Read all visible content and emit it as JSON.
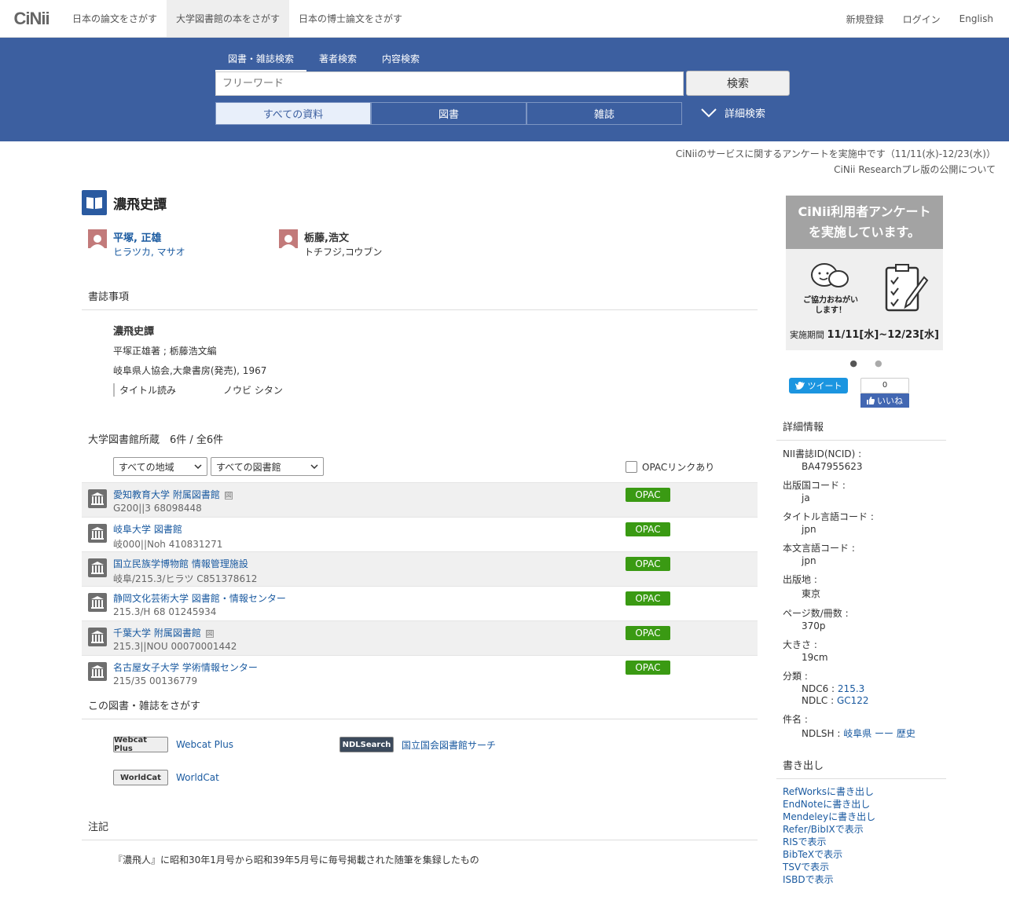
{
  "header": {
    "logo": "CiNii",
    "tabs": [
      "日本の論文をさがす",
      "大学図書館の本をさがす",
      "日本の博士論文をさがす"
    ],
    "right": [
      "新規登録",
      "ログイン",
      "English"
    ]
  },
  "search": {
    "tabs": [
      "図書・雑誌検索",
      "著者検索",
      "内容検索"
    ],
    "placeholder": "フリーワード",
    "button": "検索",
    "material_tabs": [
      "すべての資料",
      "図書",
      "雑誌"
    ],
    "advanced": "詳細検索"
  },
  "notices": [
    "CiNiiのサービスに関するアンケートを実施中です（11/11(水)-12/23(水)）",
    "CiNii Researchプレ版の公開について"
  ],
  "book": {
    "title": "濃飛史譚",
    "authors": [
      {
        "name": "平塚, 正雄",
        "kana": "ヒラツカ, マサオ"
      },
      {
        "name": "栃藤,浩文",
        "kana": "トチフジ,コウブン"
      }
    ]
  },
  "biblio": {
    "heading": "書誌事項",
    "title": "濃飛史譚",
    "resp": "平塚正雄著 ; 栃藤浩文編",
    "pub": "岐阜県人協会,大衆書房(発売), 1967",
    "yomi_label": "タイトル読み",
    "yomi_value": "ノウビ シタン"
  },
  "holdings": {
    "heading": "大学図書館所蔵　6件 / 全6件",
    "region_select": "すべての地域",
    "library_select": "すべての図書館",
    "opac_check": "OPACリンクあり",
    "opac_label": "OPAC",
    "fig_icon": "図",
    "items": [
      {
        "name": "愛知教育大学 附属図書館",
        "call": "G200||3  68098448",
        "fig": true
      },
      {
        "name": "岐阜大学 図書館",
        "call": "岐000||Noh  410831271",
        "fig": false
      },
      {
        "name": "国立民族学博物館 情報管理施設",
        "call": "岐阜/215.3/ヒラツ  C851378612",
        "fig": false
      },
      {
        "name": "静岡文化芸術大学 図書館・情報センター",
        "call": "215.3/H 68  01245934",
        "fig": false
      },
      {
        "name": "千葉大学 附属図書館",
        "call": "215.3||NOU  00070001442",
        "fig": true
      },
      {
        "name": "名古屋女子大学 学術情報センター",
        "call": "215/35  00136779",
        "fig": false
      }
    ]
  },
  "external": {
    "heading": "この図書・雑誌をさがす",
    "webcat_badge": "Webcat Plus",
    "webcat": "Webcat Plus",
    "ndl_badge": "NDLSearch",
    "ndl": "国立国会図書館サーチ",
    "worldcat_badge": "WorldCat",
    "worldcat": "WorldCat"
  },
  "notes": {
    "heading": "注記",
    "text": "『濃飛人』に昭和30年1月号から昭和39年5月号に毎号掲載された随筆を集録したもの"
  },
  "promo": {
    "line1": "CiNii利用者アンケート",
    "line2": "を実施しています。",
    "bubble": "ご協力おねがい\nします！",
    "period_label": "実施期間",
    "period": "11/11[水]~12/23[水]"
  },
  "social": {
    "tweet": "ツイート",
    "like_count": "0",
    "like": "いいね"
  },
  "details": {
    "heading": "詳細情報",
    "ncid_k": "NII書誌ID(NCID) :",
    "ncid_v": "BA47955623",
    "pubcountry_k": "出版国コード :",
    "pubcountry_v": "ja",
    "titlelang_k": "タイトル言語コード :",
    "titlelang_v": "jpn",
    "textlang_k": "本文言語コード :",
    "textlang_v": "jpn",
    "place_k": "出版地 :",
    "place_v": "東京",
    "pages_k": "ページ数/冊数 :",
    "pages_v": "370p",
    "size_k": "大きさ :",
    "size_v": "19cm",
    "class_k": "分類 :",
    "ndc6_label": "NDC6 :",
    "ndc6": "215.3",
    "ndlc_label": "NDLC :",
    "ndlc": "GC122",
    "subject_k": "件名 :",
    "ndlsh_label": "NDLSH :",
    "ndlsh": "岐阜県 ーー 歴史"
  },
  "export": {
    "heading": "書き出し",
    "items": [
      "RefWorksに書き出し",
      "EndNoteに書き出し",
      "Mendeleyに書き出し",
      "Refer/BibIXで表示",
      "RISで表示",
      "BibTeXで表示",
      "TSVで表示",
      "ISBDで表示"
    ]
  }
}
